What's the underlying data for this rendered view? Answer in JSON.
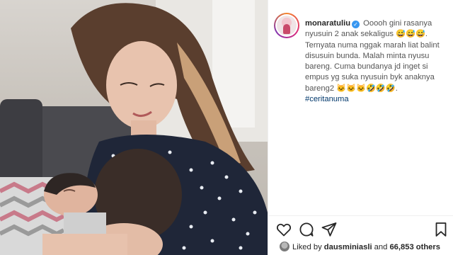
{
  "post": {
    "username": "monaratuliu",
    "verified_badge": "✓",
    "caption_lines": [
      "Ooooh gini rasanya",
      "nyusuin 2 anak sekaligus 😅😅😅.",
      "Ternyata numa nggak marah liat balint",
      "disusuin bunda. Malah minta nyusu",
      "bareng. Cuma bundanya jd inget si",
      "empus yg suka nyusuin byk anaknya",
      "bareng2 🐱🐱🐱🤣🤣🤣."
    ],
    "hashtag": "#ceritanuma"
  },
  "actions": {
    "like_icon": "heart-icon",
    "comment_icon": "comment-icon",
    "share_icon": "share-icon",
    "save_icon": "bookmark-icon"
  },
  "likes": {
    "prefix": "Liked by",
    "user": "dausminiasli",
    "connector": "and",
    "others": "66,853 others"
  },
  "colors": {
    "link": "#00376b",
    "verified": "#3897f0",
    "text": "#262626"
  }
}
